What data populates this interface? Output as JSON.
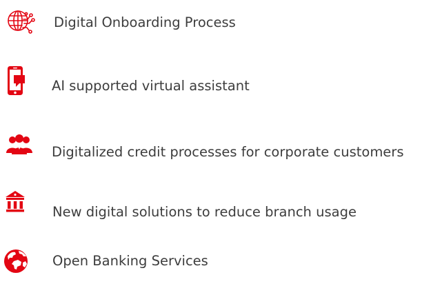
{
  "colors": {
    "accent": "#e30613",
    "text": "#3d3d3d",
    "background": "#ffffff"
  },
  "items": [
    {
      "icon": "digital-globe-network-icon",
      "label": "Digital Onboarding Process"
    },
    {
      "icon": "mobile-chat-icon",
      "label": "AI supported virtual assistant"
    },
    {
      "icon": "corporate-customers-group-icon",
      "label": "Digitalized credit processes for corporate customers"
    },
    {
      "icon": "bank-building-icon",
      "label": "New digital solutions to reduce branch usage"
    },
    {
      "icon": "globe-world-icon",
      "label": "Open Banking Services"
    }
  ]
}
